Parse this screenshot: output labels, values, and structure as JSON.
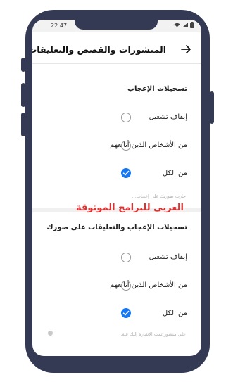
{
  "status": {
    "time": "22:47"
  },
  "header": {
    "title": "المنشورات والقصص والتعليقات"
  },
  "section1": {
    "title": "تسجيلات الإعجاب",
    "options": [
      {
        "label": "إيقاف تشغيل",
        "checked": false
      },
      {
        "label": "من الأشخاص الذين أتابعهم",
        "checked": false
      },
      {
        "label": "من الكل",
        "checked": true
      }
    ],
    "hint": "جازت صورتك على إعجاب..."
  },
  "section2": {
    "title": "تسجيلات الإعجاب والتعليقات على صورك",
    "options": [
      {
        "label": "إيقاف تشغيل",
        "checked": false
      },
      {
        "label": "من الأشخاص الذين أتابعهم",
        "checked": false
      },
      {
        "label": "من الكل",
        "checked": true
      }
    ],
    "hint": "على منشور تمت الإشارة إليك فيه."
  },
  "watermark": "العربي للبرامج الموثوقة",
  "colors": {
    "accent": "#1877f2",
    "frame": "#353a54",
    "watermark": "#e03131"
  },
  "icons": [
    "back-arrow-icon",
    "wifi-icon",
    "signal-icon",
    "battery-icon",
    "checkmark-icon",
    "info-icon"
  ]
}
